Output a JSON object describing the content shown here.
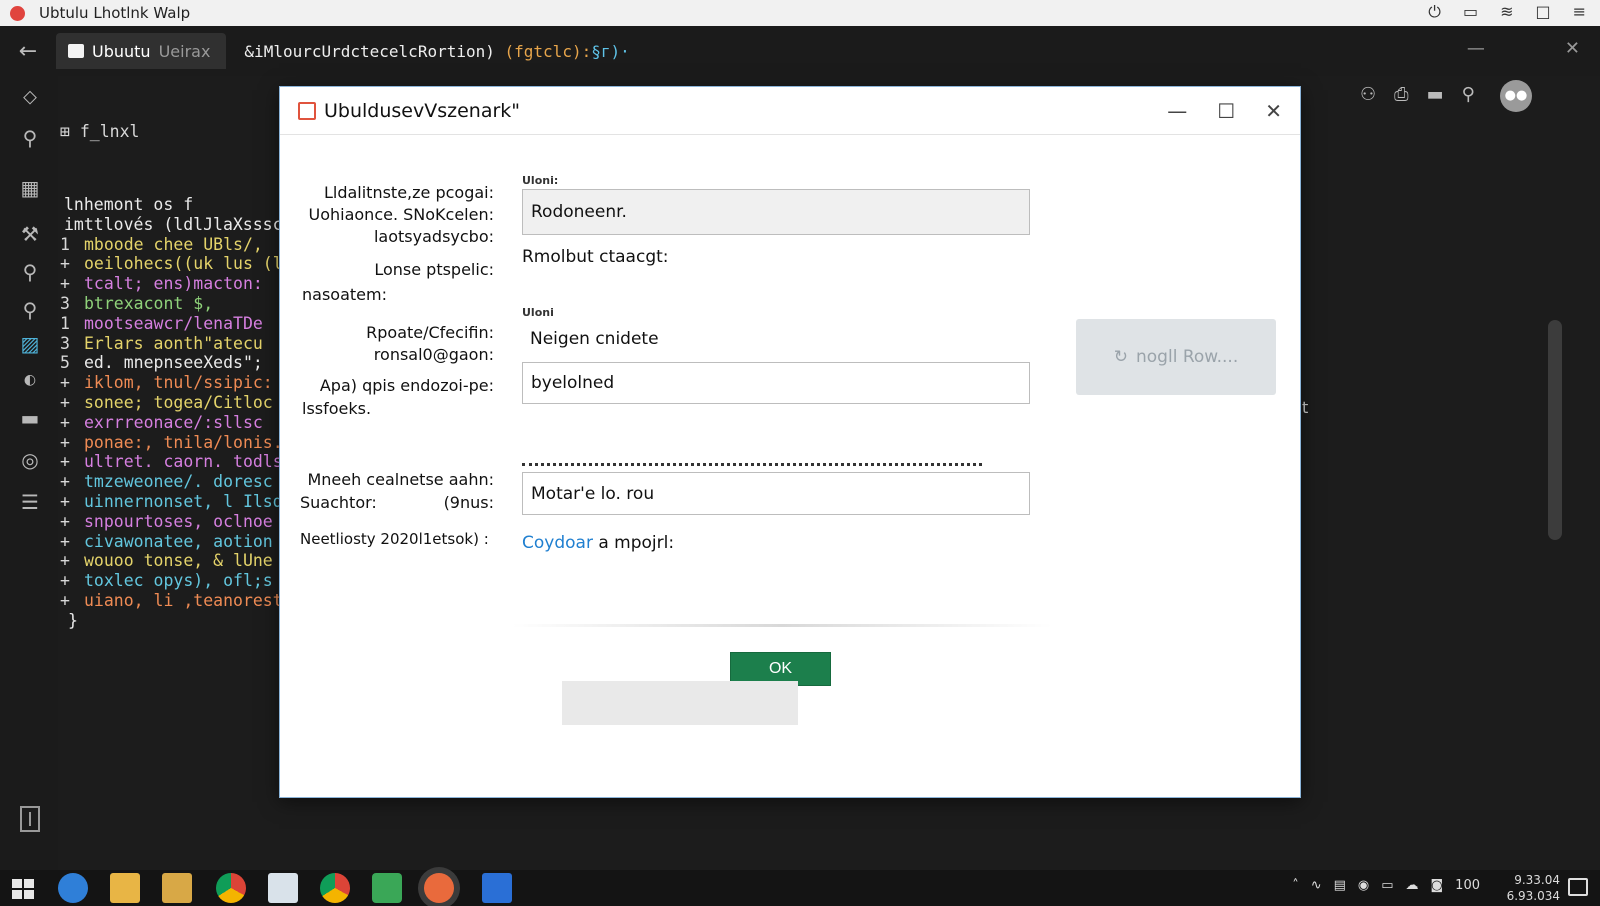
{
  "topbar": {
    "title": "Ubtulu Lhotlnk  Walp"
  },
  "tabs": {
    "active_label": "Ubuutu",
    "active_sub": "Ueirax",
    "path_main": "&iMlourcUrdctecelcRortion)",
    "path_orange": "(fgtclc):",
    "path_cyan": "§г)·"
  },
  "explorer": {
    "header": "f_lnxl"
  },
  "code": {
    "lines": [
      {
        "n": "",
        "t": "lnhemont os f",
        "c": "c-w"
      },
      {
        "n": "",
        "t": "imttlovés (ldlJlaXsssc",
        "c": "c-w"
      },
      {
        "n": "1",
        "t": "mboode chee UBls/,",
        "c": "c-y"
      },
      {
        "n": "+",
        "t": "oeilohecs((uk lus (le",
        "c": "c-y"
      },
      {
        "n": "+",
        "t": "tcalt; ens)macton:",
        "c": "c-p"
      },
      {
        "n": "3",
        "t": "btrexacont $,",
        "c": "c-g"
      },
      {
        "n": "1",
        "t": "mootseawcr/lenaTDe",
        "c": "c-p"
      },
      {
        "n": "3",
        "t": "Erlars aonth\"atecu",
        "c": "c-y"
      },
      {
        "n": "5",
        "t": "ed. mnepnseeXeds\";",
        "c": "c-w"
      },
      {
        "n": "+",
        "t": "iklom, tnul/ssipic:",
        "c": "c-o"
      },
      {
        "n": "+",
        "t": "sonee; togea/Citloc",
        "c": "c-y"
      },
      {
        "n": "+",
        "t": "exrrreonace/:sllsc",
        "c": "c-p"
      },
      {
        "n": "+",
        "t": "ponae:, tnila/lonis.",
        "c": "c-o"
      },
      {
        "n": "+",
        "t": "ultret. caorn. todlsc",
        "c": "c-p"
      },
      {
        "n": "+",
        "t": "tmzeweonee/. doresc",
        "c": "c-c"
      },
      {
        "n": "+",
        "t": "uinnernonset, l Ilsd",
        "c": "c-c"
      },
      {
        "n": "+",
        "t": "snpourtoses, oclnoe",
        "c": "c-p"
      },
      {
        "n": "+",
        "t": "civawonatee, aotion",
        "c": "c-c"
      },
      {
        "n": "+",
        "t": "wouoo tonse, & lUne",
        "c": "c-y"
      },
      {
        "n": "+",
        "t": "toxlec opys), ofl;s",
        "c": "c-c"
      },
      {
        "n": "+",
        "t": "uiano, li ,teanorest",
        "c": "c-o"
      },
      {
        "n": "",
        "t": "}",
        "c": "c-w"
      }
    ]
  },
  "dialog": {
    "title": "UbuldusevVszenark\"",
    "label_group1_line1": "Lldalitnste,ze pcogai:",
    "label_group1_line2": "Uohiaonce. SNoKcelen:",
    "label_group1_line3": "laotsyadsycbo:",
    "label_lonse": "Lonse ptspelic:",
    "label_nasoatem": "nasoatem:",
    "label_repoate": "Rpoate/Cfecifin:",
    "label_ronsal": "ronsal0@gaon:",
    "label_apa": "Apa) qpis endozoi-pe:",
    "label_issfoeks": "lssfoeks.",
    "label_mneeh": "Mneeh cealnetse aahn:",
    "label_suachtor": "Suachtor:",
    "label_9nus": "(9nus:",
    "label_neetliosty": "Neetliosty 2020l1etsok) :",
    "cap1": "Uloni:",
    "cap2": "Uloni",
    "field1_value": "Rodoneenr.",
    "row_rmolbut": "Rmolbut ctaacgt:",
    "row_neigen": "Neigen cnidete",
    "field2_value": "byelolned",
    "field3_value": "Motar'e lo. rou",
    "link_text": "Coydoar",
    "link_rest": " a mpojrl:",
    "ghost_button": "nogll Row....",
    "ok": "OK"
  },
  "stray_char": "t",
  "tray": {
    "volume": "100",
    "time": "9.33.04",
    "date": "6.93.034"
  }
}
